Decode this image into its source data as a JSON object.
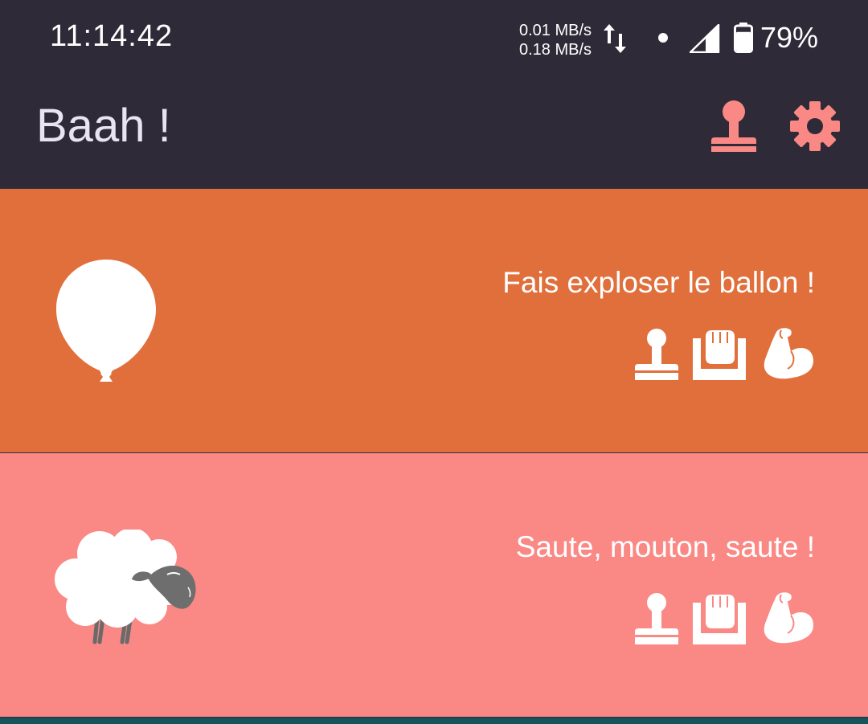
{
  "status_bar": {
    "time": "11:14:42",
    "upload_speed": "0.01 MB/s",
    "download_speed": "0.18 MB/s",
    "battery_percent": "79%",
    "battery_level": 0.79
  },
  "app_bar": {
    "title": "Baah !",
    "actions": [
      {
        "icon": "joystick-icon",
        "label": ""
      },
      {
        "icon": "gear-icon",
        "label": ""
      }
    ]
  },
  "games": [
    {
      "title": "Fais exploser le ballon !",
      "icon": "balloon-icon",
      "badges": [
        "joystick-icon",
        "fist-tray-icon",
        "flexed-biceps-icon"
      ]
    },
    {
      "title": "Saute, mouton, saute !",
      "icon": "sheep-icon",
      "badges": [
        "joystick-icon",
        "fist-tray-icon",
        "flexed-biceps-icon"
      ]
    }
  ],
  "colors": {
    "background": "#2e2a38",
    "accent": "#fa8885",
    "card_orange": "#e06f3c",
    "card_pink": "#fa8885",
    "bottom_strip": "#14545a"
  }
}
